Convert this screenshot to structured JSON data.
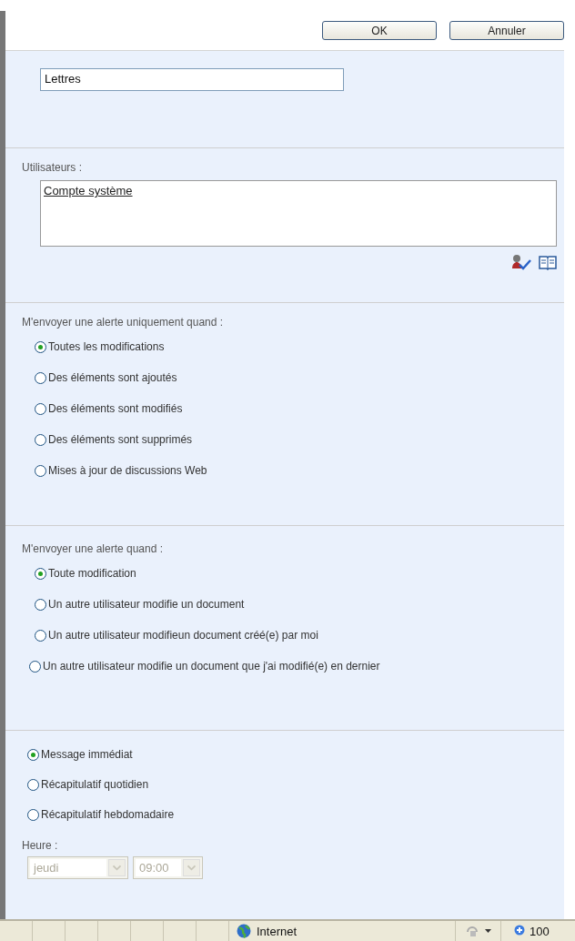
{
  "buttons": [
    {
      "label": "OK"
    },
    {
      "label": "Annuler"
    }
  ],
  "title_field": {
    "value": "Lettres"
  },
  "users": {
    "label": "Utilisateurs :",
    "value": "Compte système"
  },
  "change_type": {
    "label": "M'envoyer une alerte uniquement quand :",
    "options": [
      {
        "label": "Toutes les modifications",
        "selected": true
      },
      {
        "label": "Des éléments sont ajoutés",
        "selected": false
      },
      {
        "label": "Des éléments sont modifiés",
        "selected": false
      },
      {
        "label": "Des éléments sont supprimés",
        "selected": false
      },
      {
        "label": "Mises à jour de discussions Web",
        "selected": false
      }
    ]
  },
  "filter": {
    "label": "M'envoyer une alerte quand :",
    "options": [
      {
        "label": "Toute modification",
        "selected": true
      },
      {
        "label": "Un autre utilisateur modifie un document",
        "selected": false
      },
      {
        "label": "Un autre utilisateur modifieun document créé(e) par moi",
        "selected": false
      },
      {
        "label": "Un autre utilisateur modifie un document que j'ai modifié(e) en dernier",
        "selected": false
      }
    ]
  },
  "frequency": {
    "options": [
      {
        "label": "Message immédiat",
        "selected": true
      },
      {
        "label": "Récapitulatif quotidien",
        "selected": false
      },
      {
        "label": "Récapitulatif hebdomadaire",
        "selected": false
      }
    ],
    "time_label": "Heure :",
    "day": {
      "value": "jeudi",
      "disabled": true
    },
    "time": {
      "value": "09:00",
      "disabled": true
    }
  },
  "status_bar": {
    "zone": "Internet",
    "zoom": "100"
  }
}
